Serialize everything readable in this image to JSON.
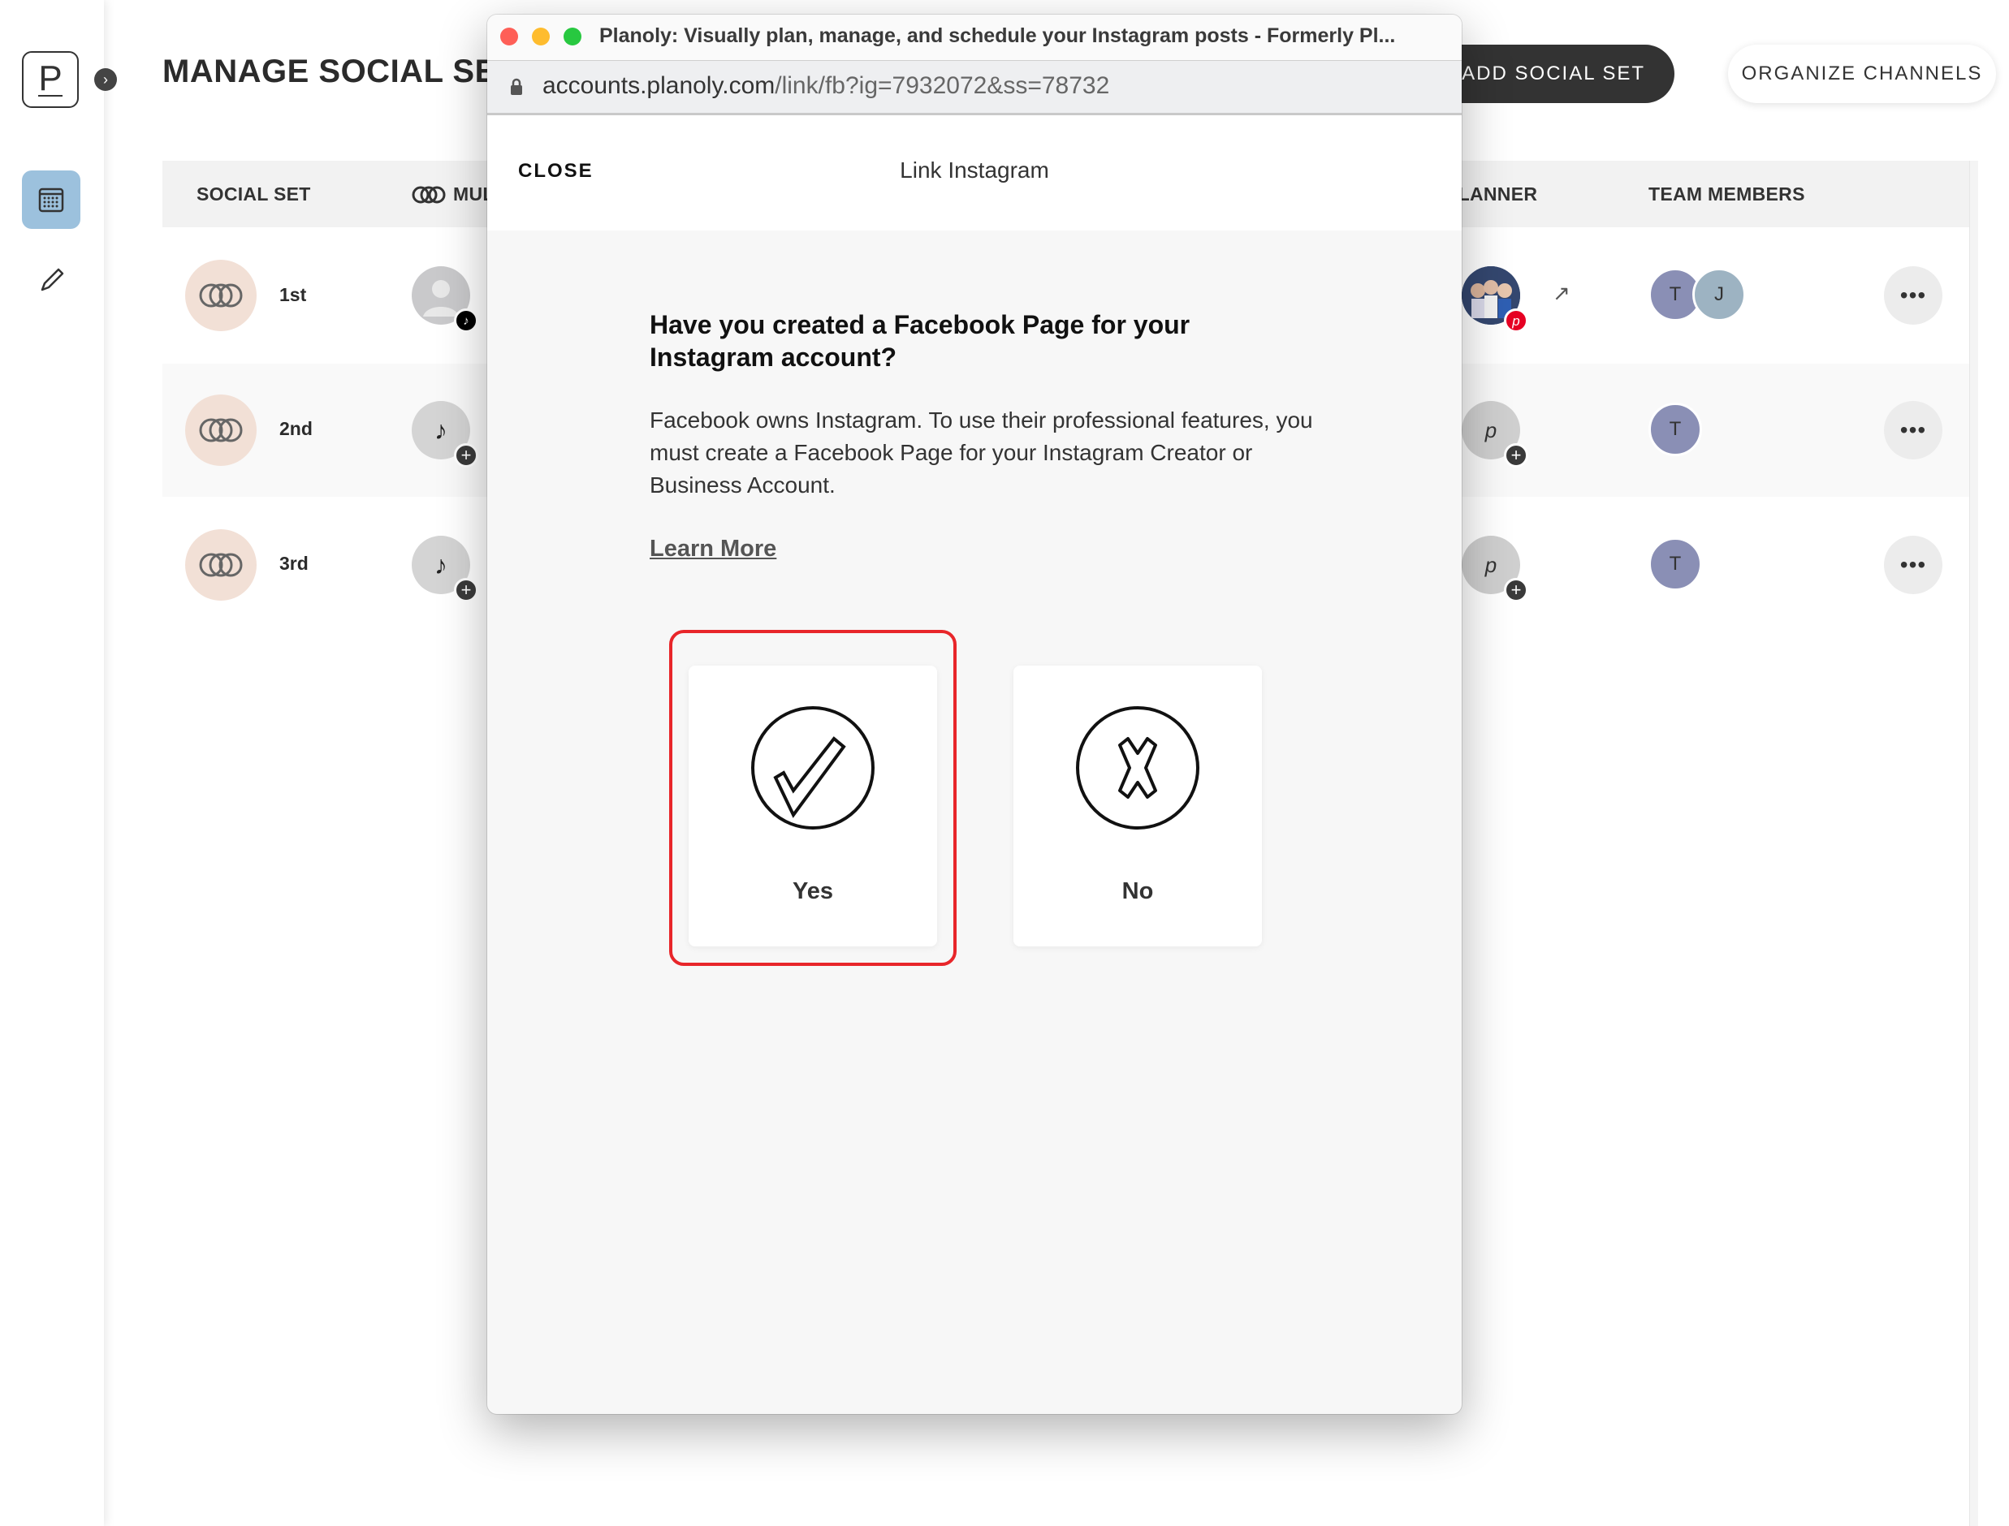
{
  "sidebar": {
    "logo_letter": "P",
    "items": [
      {
        "name": "calendar",
        "active": true
      },
      {
        "name": "compose",
        "active": false
      }
    ],
    "active_color": "#9cc1dd"
  },
  "header": {
    "title": "MANAGE SOCIAL SETS",
    "add_button": "+ ADD SOCIAL SET",
    "organize_button": "ORGANIZE CHANNELS"
  },
  "table": {
    "columns": [
      "SOCIAL SET",
      "MULTI",
      "PLANNER",
      "TEAM MEMBERS"
    ],
    "rows": [
      {
        "name": "1st",
        "channel": "tiktok",
        "channel_linked": true,
        "planner": "pinterest",
        "planner_linked": true,
        "members": [
          "T",
          "J"
        ]
      },
      {
        "name": "2nd",
        "channel": "tiktok",
        "channel_linked": false,
        "planner": "pinterest",
        "planner_linked": false,
        "members": [
          "T"
        ]
      },
      {
        "name": "3rd",
        "channel": "tiktok",
        "channel_linked": false,
        "planner": "pinterest",
        "planner_linked": false,
        "members": [
          "T"
        ]
      }
    ],
    "more_label": "•••"
  },
  "popup": {
    "window_title": "Planoly: Visually plan, manage, and schedule your Instagram posts - Formerly Pl...",
    "url_host": "accounts.planoly.com",
    "url_path": "/link/fb?ig=7932072&ss=78732",
    "close_label": "CLOSE",
    "modal_title": "Link Instagram",
    "question": "Have you created a Facebook Page for your Instagram account?",
    "description": "Facebook owns Instagram. To use their professional features, you must create a Facebook Page for your Instagram Creator or Business Account.",
    "learn_more": "Learn More",
    "options": [
      {
        "label": "Yes",
        "icon": "check-circle-icon",
        "highlighted": true
      },
      {
        "label": "No",
        "icon": "x-circle-icon",
        "highlighted": false
      }
    ],
    "highlight_color": "#e8262a"
  },
  "colors": {
    "member_T": "#8a8fb5",
    "member_J": "#9db3c2",
    "pinterest": "#e60023",
    "social_set_bg": "#f2e0d6"
  }
}
